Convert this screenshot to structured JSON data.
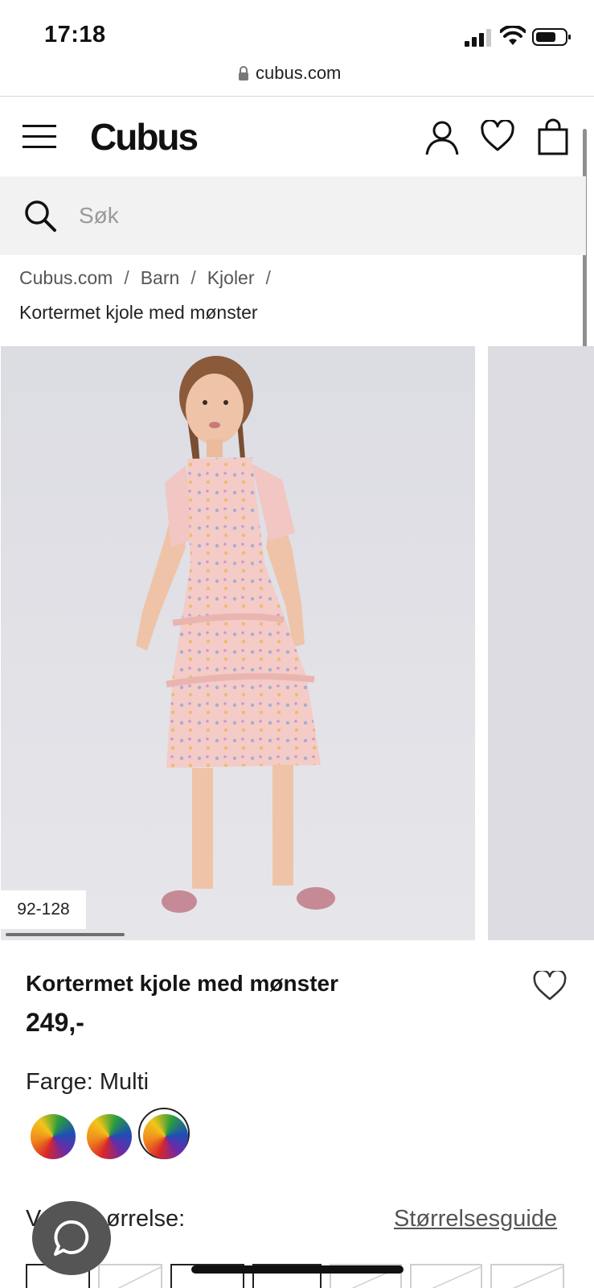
{
  "status_bar": {
    "time": "17:18"
  },
  "browser": {
    "url": "cubus.com"
  },
  "header": {
    "logo": "Cubus"
  },
  "search": {
    "placeholder": "Søk"
  },
  "breadcrumb": {
    "items": [
      "Cubus.com",
      "Barn",
      "Kjoler"
    ],
    "separator": "/",
    "current": "Kortermet kjole med mønster"
  },
  "gallery": {
    "size_range": "92-128"
  },
  "product": {
    "title": "Kortermet kjole med mønster",
    "price": "249,-",
    "color_label": "Farge: Multi",
    "swatch_count": 3,
    "selected_swatch": 3,
    "size_label": "Velg størrelse:",
    "size_label_visible": "V          ørrelse:",
    "size_guide": "Størrelsesguide"
  },
  "colors": {
    "text": "#111111",
    "search_bg": "#f2f2f2",
    "photo_bg": "#e0e0e6",
    "chat_bg": "#555555"
  },
  "icons": [
    "menu-icon",
    "user-icon",
    "heart-icon",
    "bag-icon",
    "search-icon",
    "lock-icon",
    "chat-icon"
  ]
}
